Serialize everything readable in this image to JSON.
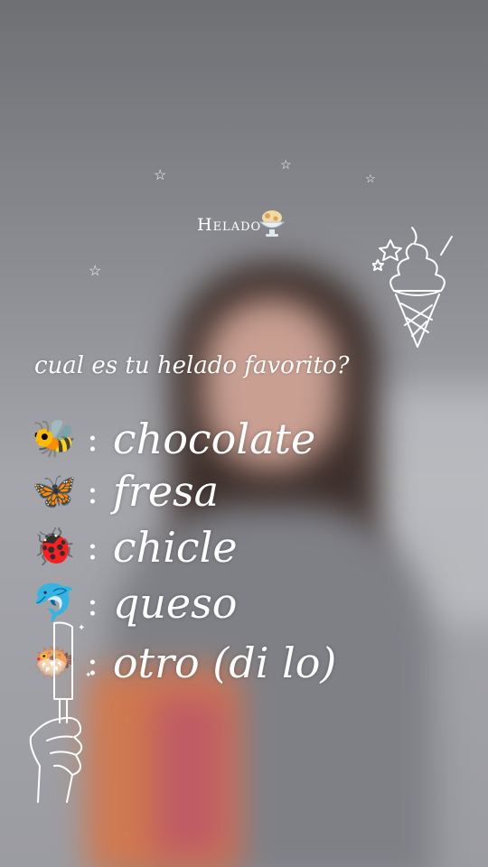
{
  "header": {
    "title": "Helado",
    "title_icon": "ice-cream-bowl-icon"
  },
  "question": "cual es tu helado favorito?",
  "options": [
    {
      "icon": "bee-icon",
      "emoji": "🐝",
      "sep": ":",
      "label": "chocolate"
    },
    {
      "icon": "butterfly-icon",
      "emoji": "🦋",
      "sep": ":",
      "label": "fresa"
    },
    {
      "icon": "ladybug-icon",
      "emoji": "🐞",
      "sep": ":",
      "label": "chicle"
    },
    {
      "icon": "dolphin-icon",
      "emoji": "🐬",
      "sep": ":",
      "label": "queso"
    },
    {
      "icon": "pufferfish-icon",
      "emoji": "🐡",
      "sep": ":",
      "label": "otro (di lo)"
    }
  ],
  "decorations": [
    "star-icon",
    "ice-cream-cone-icon",
    "hand-holding-popsicle-icon"
  ],
  "colors": {
    "text": "#ffffff",
    "background": "#8d8e93"
  }
}
